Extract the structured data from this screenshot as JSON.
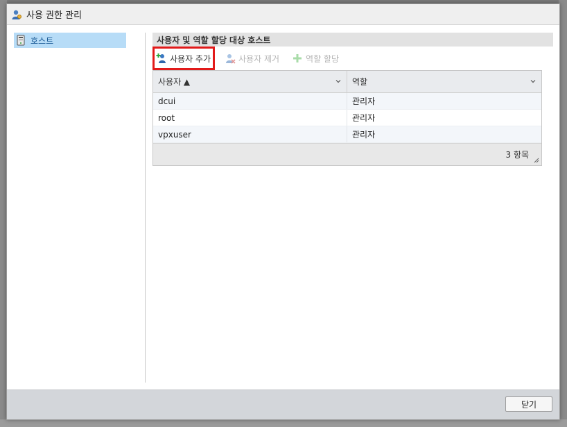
{
  "dialog": {
    "title": "사용 권한 관리",
    "close_label": "닫기"
  },
  "nav": {
    "items": [
      {
        "label": "호스트",
        "icon": "host-icon"
      }
    ]
  },
  "panel": {
    "header": "사용자 및 역할 할당 대상 호스트",
    "toolbar": {
      "add_user": "사용자 추가",
      "remove_user": "사용자 제거",
      "assign_role": "역할 할당"
    }
  },
  "grid": {
    "columns": [
      "사용자 ▲",
      "역할"
    ],
    "rows": [
      {
        "user": "dcui",
        "role": "관리자"
      },
      {
        "user": "root",
        "role": "관리자"
      },
      {
        "user": "vpxuser",
        "role": "관리자"
      }
    ],
    "count": "3 항목"
  },
  "colors": {
    "accent": "#b7dcf7",
    "highlight": "#e21a1a"
  }
}
